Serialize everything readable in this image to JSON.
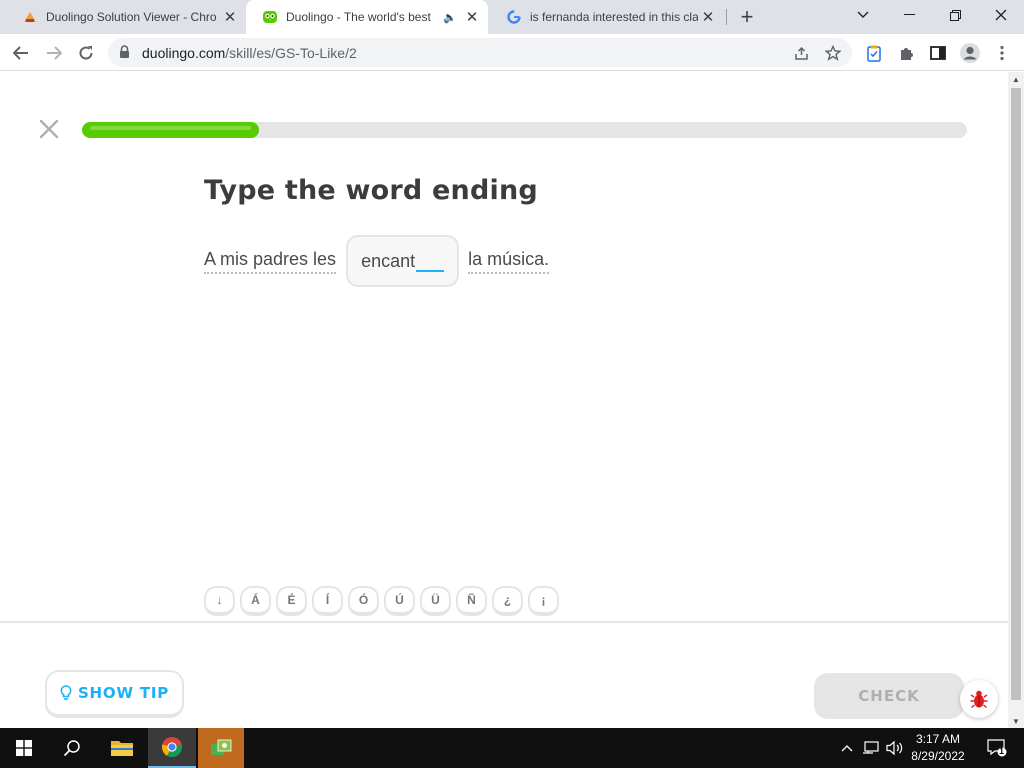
{
  "browser": {
    "tabs": [
      {
        "title": "Duolingo Solution Viewer - Chro",
        "favicon": "extension-icon",
        "active": false
      },
      {
        "title": "Duolingo - The world's best",
        "favicon": "duolingo-owl-icon",
        "active": true
      },
      {
        "title": "is fernanda interested in this clas",
        "favicon": "google-g-icon",
        "active": false
      }
    ],
    "url_host": "duolingo.com",
    "url_path": "/skill/es/GS-To-Like/2"
  },
  "lesson": {
    "progress_fraction": 0.2,
    "prompt": "Type the word ending",
    "sentence": {
      "before_words": [
        "A mis padres les"
      ],
      "stem": "encant",
      "after_words": [
        "la música."
      ]
    },
    "special_chars": [
      "↓",
      "Á",
      "É",
      "Í",
      "Ó",
      "Ú",
      "Ü",
      "Ñ",
      "¿",
      "¡"
    ]
  },
  "footer": {
    "tip_label": "SHOW TIP",
    "check_label": "CHECK"
  },
  "taskbar": {
    "time": "3:17 AM",
    "date": "8/29/2022",
    "notification_count": "1"
  },
  "colors": {
    "progress_fill": "#58cc02",
    "accent_blue": "#1cb0f6",
    "disabled_gray": "#e5e5e5"
  }
}
